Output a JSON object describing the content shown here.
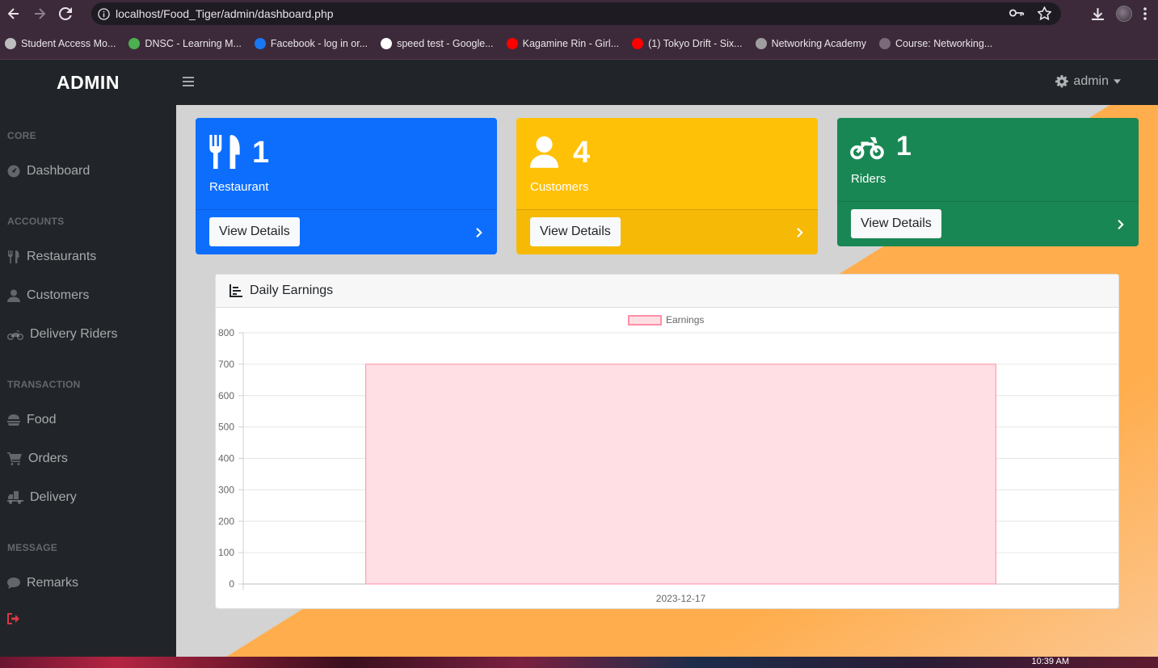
{
  "browser": {
    "url": "localhost/Food_Tiger/admin/dashboard.php",
    "bookmarks": [
      {
        "label": "Student Access Mo...",
        "icon": "globe-icon",
        "color": "#bdbdbd"
      },
      {
        "label": "DNSC - Learning M...",
        "icon": "dnsc-logo-icon",
        "color": "#4caf50"
      },
      {
        "label": "Facebook - log in or...",
        "icon": "facebook-icon",
        "color": "#1877f2"
      },
      {
        "label": "speed test - Google...",
        "icon": "google-icon",
        "color": "#ffffff"
      },
      {
        "label": "Kagamine Rin - Girl...",
        "icon": "youtube-icon",
        "color": "#ff0000"
      },
      {
        "label": "(1) Tokyo Drift - Six...",
        "icon": "youtube-icon",
        "color": "#ff0000"
      },
      {
        "label": "Networking Academy",
        "icon": "cisco-icon",
        "color": "#9e9e9e"
      },
      {
        "label": "Course: Networking...",
        "icon": "course-icon",
        "color": "#7a6a7a"
      }
    ]
  },
  "app": {
    "brand": "ADMIN",
    "user": "admin"
  },
  "sidebar": {
    "headings": [
      "CORE",
      "ACCOUNTS",
      "TRANSACTION",
      "MESSAGE"
    ],
    "items": [
      {
        "label": "Dashboard",
        "icon": "dashboard-icon"
      },
      {
        "label": "Restaurants",
        "icon": "utensils-icon"
      },
      {
        "label": "Customers",
        "icon": "user-icon"
      },
      {
        "label": "Delivery Riders",
        "icon": "motorcycle-icon"
      },
      {
        "label": "Food",
        "icon": "hamburger-food-icon"
      },
      {
        "label": "Orders",
        "icon": "cart-icon"
      },
      {
        "label": "Delivery",
        "icon": "truck-icon"
      },
      {
        "label": "Remarks",
        "icon": "comment-icon"
      },
      {
        "label": "",
        "icon": "logout-icon"
      }
    ]
  },
  "cards": [
    {
      "count": "1",
      "label": "Restaurant",
      "button": "View Details",
      "color": "#0d6efd",
      "icon": "utensils-icon"
    },
    {
      "count": "4",
      "label": "Customers",
      "button": "View Details",
      "color": "#ffc107",
      "icon": "user-icon"
    },
    {
      "count": "1",
      "label": "Riders",
      "button": "View Details",
      "color": "#198754",
      "icon": "motorcycle-icon"
    }
  ],
  "chart_panel": {
    "title": "Daily Earnings"
  },
  "chart_data": {
    "type": "bar",
    "categories": [
      "2023-12-17"
    ],
    "series": [
      {
        "name": "Earnings",
        "values": [
          700
        ]
      }
    ],
    "ylim": [
      0,
      800
    ],
    "yticks": [
      0,
      100,
      200,
      300,
      400,
      500,
      600,
      700,
      800
    ],
    "legend": "top-center",
    "grid": true,
    "bar_fill": "#ffdfe4",
    "bar_stroke": "#ff8fa6"
  },
  "taskbar": {
    "clock": "10:39 AM"
  }
}
